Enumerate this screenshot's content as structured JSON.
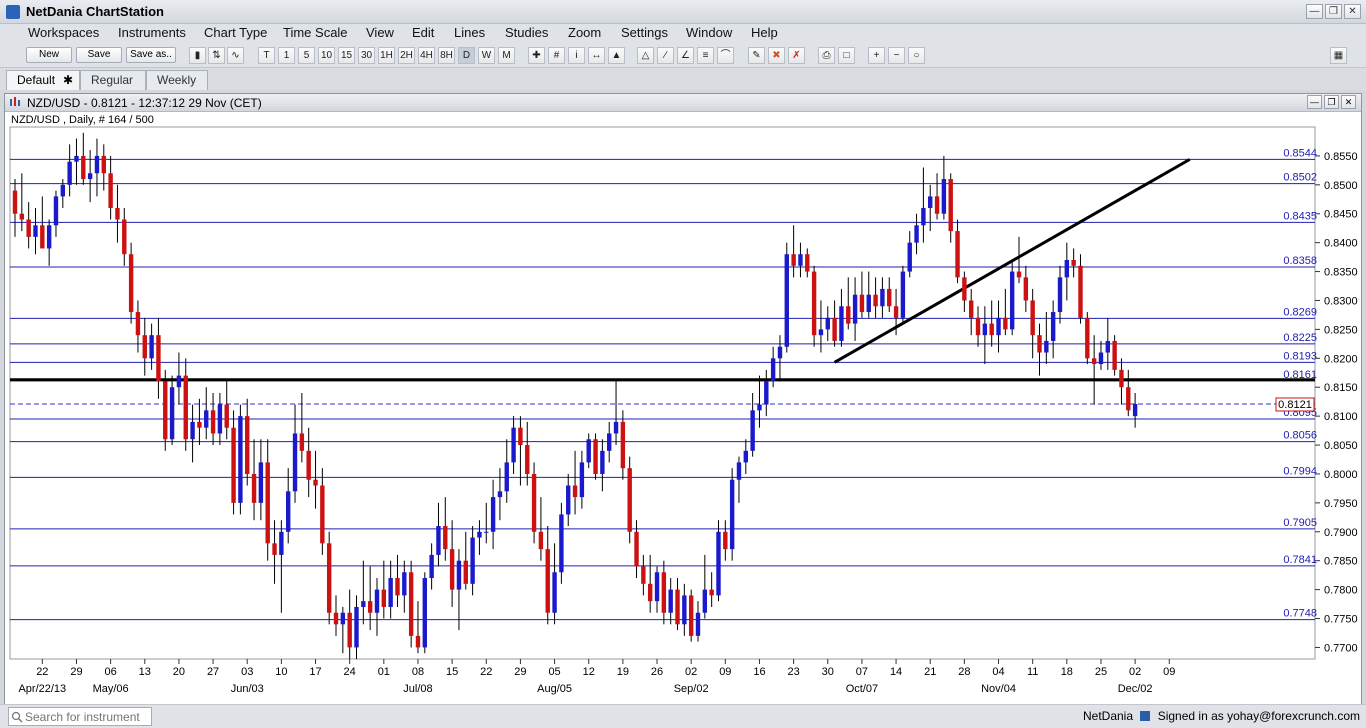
{
  "app": {
    "title": "NetDania ChartStation"
  },
  "menu": [
    "Workspaces",
    "Instruments",
    "Chart Type",
    "Time Scale",
    "View",
    "Edit",
    "Lines",
    "Studies",
    "Zoom",
    "Settings",
    "Window",
    "Help"
  ],
  "toolbar": {
    "new_label": "New",
    "save_label": "Save",
    "save_as_label": "Save as..",
    "timescales": [
      "T",
      "1",
      "5",
      "10",
      "15",
      "30",
      "1H",
      "2H",
      "4H",
      "8H",
      "D",
      "W",
      "M"
    ]
  },
  "tabs": [
    "Default",
    "Regular",
    "Weekly"
  ],
  "chart_window": {
    "title": "NZD/USD - 0.8121 - 12:37:12  29 Nov (CET)"
  },
  "status": {
    "search_placeholder": "Search for instrument",
    "brand": "NetDania",
    "signed_in": "Signed in as yohay@forexcrunch.com"
  },
  "colors": {
    "bull": "#1a1acc",
    "bear": "#cc1111",
    "grid": "#2020b0",
    "price_line": "#3030d0"
  },
  "chart_data": {
    "type": "candlestick",
    "title": "NZD/USD , Daily, # 164 / 500",
    "ylim": [
      0.768,
      0.86
    ],
    "y_ticks": [
      0.855,
      0.85,
      0.845,
      0.84,
      0.835,
      0.83,
      0.825,
      0.82,
      0.815,
      0.81,
      0.805,
      0.8,
      0.795,
      0.79,
      0.785,
      0.78,
      0.775,
      0.77
    ],
    "y_tick_labels": [
      "0.8550",
      "0.8500",
      "0.8450",
      "0.8400",
      "0.8350",
      "0.8300",
      "0.8250",
      "0.8200",
      "0.8150",
      "0.8100",
      "0.8050",
      "0.8000",
      "0.7950",
      "0.7900",
      "0.7850",
      "0.7800",
      "0.7750",
      "0.7700"
    ],
    "x_ticks": [
      {
        "i": 4,
        "day": "22",
        "month": "Apr/22/13"
      },
      {
        "i": 9,
        "day": "29"
      },
      {
        "i": 14,
        "day": "06",
        "month": "May/06"
      },
      {
        "i": 19,
        "day": "13"
      },
      {
        "i": 24,
        "day": "20"
      },
      {
        "i": 29,
        "day": "27"
      },
      {
        "i": 34,
        "day": "03",
        "month": "Jun/03"
      },
      {
        "i": 39,
        "day": "10"
      },
      {
        "i": 44,
        "day": "17"
      },
      {
        "i": 49,
        "day": "24"
      },
      {
        "i": 54,
        "day": "01"
      },
      {
        "i": 59,
        "day": "08",
        "month": "Jul/08"
      },
      {
        "i": 64,
        "day": "15"
      },
      {
        "i": 69,
        "day": "22"
      },
      {
        "i": 74,
        "day": "29"
      },
      {
        "i": 79,
        "day": "05",
        "month": "Aug/05"
      },
      {
        "i": 84,
        "day": "12"
      },
      {
        "i": 89,
        "day": "19"
      },
      {
        "i": 94,
        "day": "26"
      },
      {
        "i": 99,
        "day": "02",
        "month": "Sep/02"
      },
      {
        "i": 104,
        "day": "09"
      },
      {
        "i": 109,
        "day": "16"
      },
      {
        "i": 114,
        "day": "23"
      },
      {
        "i": 119,
        "day": "30"
      },
      {
        "i": 124,
        "day": "07",
        "month": "Oct/07"
      },
      {
        "i": 129,
        "day": "14"
      },
      {
        "i": 134,
        "day": "21"
      },
      {
        "i": 139,
        "day": "28"
      },
      {
        "i": 144,
        "day": "04",
        "month": "Nov/04"
      },
      {
        "i": 149,
        "day": "11"
      },
      {
        "i": 154,
        "day": "18"
      },
      {
        "i": 159,
        "day": "25"
      },
      {
        "i": 164,
        "day": "02",
        "month": "Dec/02"
      },
      {
        "i": 169,
        "day": "09"
      }
    ],
    "levels": [
      0.8544,
      0.8502,
      0.8435,
      0.8358,
      0.8269,
      0.8225,
      0.8193,
      0.8161,
      0.8095,
      0.8056,
      0.7994,
      0.7905,
      0.7841,
      0.7748
    ],
    "level_labels": [
      "0.8544",
      "0.8502",
      "0.8435",
      "0.8358",
      "0.8269",
      "0.8225",
      "0.8193",
      "0.8161",
      "0.8095",
      "0.8056",
      "0.7994",
      "0.7905",
      "0.7841",
      "0.7748"
    ],
    "support_level": 0.8163,
    "current_price": 0.8121,
    "current_price_label": "0.8121",
    "trendlines": [
      {
        "from": {
          "i": 120,
          "price": 0.8193
        },
        "to": {
          "i": 172,
          "price": 0.8544
        }
      }
    ],
    "candles": [
      [
        0.849,
        0.851,
        0.841,
        0.845
      ],
      [
        0.845,
        0.852,
        0.842,
        0.844
      ],
      [
        0.844,
        0.847,
        0.839,
        0.841
      ],
      [
        0.841,
        0.846,
        0.838,
        0.843
      ],
      [
        0.843,
        0.848,
        0.84,
        0.839
      ],
      [
        0.839,
        0.844,
        0.836,
        0.843
      ],
      [
        0.843,
        0.849,
        0.841,
        0.848
      ],
      [
        0.848,
        0.851,
        0.846,
        0.85
      ],
      [
        0.85,
        0.857,
        0.848,
        0.854
      ],
      [
        0.854,
        0.858,
        0.85,
        0.855
      ],
      [
        0.855,
        0.859,
        0.85,
        0.851
      ],
      [
        0.851,
        0.856,
        0.847,
        0.852
      ],
      [
        0.852,
        0.858,
        0.848,
        0.855
      ],
      [
        0.855,
        0.857,
        0.849,
        0.852
      ],
      [
        0.852,
        0.855,
        0.844,
        0.846
      ],
      [
        0.846,
        0.85,
        0.84,
        0.844
      ],
      [
        0.844,
        0.846,
        0.836,
        0.838
      ],
      [
        0.838,
        0.84,
        0.826,
        0.828
      ],
      [
        0.828,
        0.83,
        0.821,
        0.824
      ],
      [
        0.824,
        0.827,
        0.817,
        0.82
      ],
      [
        0.82,
        0.826,
        0.818,
        0.824
      ],
      [
        0.824,
        0.827,
        0.813,
        0.816
      ],
      [
        0.816,
        0.818,
        0.804,
        0.806
      ],
      [
        0.806,
        0.817,
        0.805,
        0.815
      ],
      [
        0.815,
        0.821,
        0.812,
        0.817
      ],
      [
        0.817,
        0.82,
        0.804,
        0.806
      ],
      [
        0.806,
        0.812,
        0.802,
        0.809
      ],
      [
        0.809,
        0.813,
        0.805,
        0.808
      ],
      [
        0.808,
        0.815,
        0.806,
        0.811
      ],
      [
        0.811,
        0.814,
        0.805,
        0.807
      ],
      [
        0.807,
        0.814,
        0.805,
        0.812
      ],
      [
        0.812,
        0.816,
        0.806,
        0.808
      ],
      [
        0.808,
        0.811,
        0.793,
        0.795
      ],
      [
        0.795,
        0.812,
        0.793,
        0.81
      ],
      [
        0.81,
        0.813,
        0.798,
        0.8
      ],
      [
        0.8,
        0.806,
        0.792,
        0.795
      ],
      [
        0.795,
        0.806,
        0.792,
        0.802
      ],
      [
        0.802,
        0.806,
        0.785,
        0.788
      ],
      [
        0.788,
        0.792,
        0.781,
        0.786
      ],
      [
        0.786,
        0.792,
        0.776,
        0.79
      ],
      [
        0.79,
        0.801,
        0.788,
        0.797
      ],
      [
        0.797,
        0.812,
        0.795,
        0.807
      ],
      [
        0.807,
        0.814,
        0.802,
        0.804
      ],
      [
        0.804,
        0.808,
        0.796,
        0.799
      ],
      [
        0.799,
        0.804,
        0.794,
        0.798
      ],
      [
        0.798,
        0.801,
        0.786,
        0.788
      ],
      [
        0.788,
        0.79,
        0.774,
        0.776
      ],
      [
        0.776,
        0.779,
        0.772,
        0.774
      ],
      [
        0.774,
        0.777,
        0.769,
        0.776
      ],
      [
        0.776,
        0.78,
        0.768,
        0.77
      ],
      [
        0.77,
        0.779,
        0.768,
        0.777
      ],
      [
        0.777,
        0.785,
        0.774,
        0.778
      ],
      [
        0.778,
        0.784,
        0.773,
        0.776
      ],
      [
        0.776,
        0.782,
        0.772,
        0.78
      ],
      [
        0.78,
        0.785,
        0.775,
        0.777
      ],
      [
        0.777,
        0.785,
        0.775,
        0.782
      ],
      [
        0.782,
        0.786,
        0.777,
        0.779
      ],
      [
        0.779,
        0.785,
        0.776,
        0.783
      ],
      [
        0.783,
        0.785,
        0.77,
        0.772
      ],
      [
        0.772,
        0.778,
        0.769,
        0.77
      ],
      [
        0.77,
        0.783,
        0.769,
        0.782
      ],
      [
        0.782,
        0.788,
        0.78,
        0.786
      ],
      [
        0.786,
        0.795,
        0.784,
        0.791
      ],
      [
        0.791,
        0.796,
        0.785,
        0.787
      ],
      [
        0.787,
        0.792,
        0.777,
        0.78
      ],
      [
        0.78,
        0.787,
        0.773,
        0.785
      ],
      [
        0.785,
        0.79,
        0.78,
        0.781
      ],
      [
        0.781,
        0.791,
        0.779,
        0.789
      ],
      [
        0.789,
        0.792,
        0.786,
        0.79
      ],
      [
        0.79,
        0.795,
        0.788,
        0.79
      ],
      [
        0.79,
        0.799,
        0.787,
        0.796
      ],
      [
        0.796,
        0.801,
        0.792,
        0.797
      ],
      [
        0.797,
        0.806,
        0.795,
        0.802
      ],
      [
        0.802,
        0.81,
        0.8,
        0.808
      ],
      [
        0.808,
        0.81,
        0.798,
        0.805
      ],
      [
        0.805,
        0.809,
        0.798,
        0.8
      ],
      [
        0.8,
        0.802,
        0.788,
        0.79
      ],
      [
        0.79,
        0.796,
        0.785,
        0.787
      ],
      [
        0.787,
        0.791,
        0.774,
        0.776
      ],
      [
        0.776,
        0.788,
        0.774,
        0.783
      ],
      [
        0.783,
        0.795,
        0.781,
        0.793
      ],
      [
        0.793,
        0.8,
        0.791,
        0.798
      ],
      [
        0.798,
        0.804,
        0.793,
        0.796
      ],
      [
        0.796,
        0.804,
        0.794,
        0.802
      ],
      [
        0.802,
        0.807,
        0.801,
        0.806
      ],
      [
        0.806,
        0.807,
        0.799,
        0.8
      ],
      [
        0.8,
        0.806,
        0.797,
        0.804
      ],
      [
        0.804,
        0.809,
        0.802,
        0.807
      ],
      [
        0.807,
        0.816,
        0.805,
        0.809
      ],
      [
        0.809,
        0.811,
        0.799,
        0.801
      ],
      [
        0.801,
        0.803,
        0.788,
        0.79
      ],
      [
        0.79,
        0.792,
        0.782,
        0.784
      ],
      [
        0.784,
        0.786,
        0.779,
        0.781
      ],
      [
        0.781,
        0.786,
        0.776,
        0.778
      ],
      [
        0.778,
        0.784,
        0.776,
        0.783
      ],
      [
        0.783,
        0.785,
        0.774,
        0.776
      ],
      [
        0.776,
        0.782,
        0.774,
        0.78
      ],
      [
        0.78,
        0.782,
        0.773,
        0.774
      ],
      [
        0.774,
        0.781,
        0.772,
        0.779
      ],
      [
        0.779,
        0.78,
        0.771,
        0.772
      ],
      [
        0.772,
        0.778,
        0.771,
        0.776
      ],
      [
        0.776,
        0.786,
        0.775,
        0.78
      ],
      [
        0.78,
        0.783,
        0.777,
        0.779
      ],
      [
        0.779,
        0.792,
        0.778,
        0.79
      ],
      [
        0.79,
        0.792,
        0.785,
        0.787
      ],
      [
        0.787,
        0.801,
        0.785,
        0.799
      ],
      [
        0.799,
        0.803,
        0.795,
        0.802
      ],
      [
        0.802,
        0.806,
        0.8,
        0.804
      ],
      [
        0.804,
        0.814,
        0.803,
        0.811
      ],
      [
        0.811,
        0.817,
        0.808,
        0.812
      ],
      [
        0.812,
        0.818,
        0.81,
        0.816
      ],
      [
        0.816,
        0.822,
        0.815,
        0.82
      ],
      [
        0.82,
        0.824,
        0.816,
        0.822
      ],
      [
        0.822,
        0.84,
        0.821,
        0.838
      ],
      [
        0.838,
        0.843,
        0.834,
        0.836
      ],
      [
        0.836,
        0.84,
        0.834,
        0.838
      ],
      [
        0.838,
        0.839,
        0.834,
        0.835
      ],
      [
        0.835,
        0.836,
        0.822,
        0.824
      ],
      [
        0.824,
        0.83,
        0.821,
        0.825
      ],
      [
        0.825,
        0.829,
        0.823,
        0.827
      ],
      [
        0.827,
        0.83,
        0.822,
        0.823
      ],
      [
        0.823,
        0.832,
        0.822,
        0.829
      ],
      [
        0.829,
        0.834,
        0.825,
        0.826
      ],
      [
        0.826,
        0.834,
        0.823,
        0.831
      ],
      [
        0.831,
        0.835,
        0.827,
        0.828
      ],
      [
        0.828,
        0.835,
        0.827,
        0.831
      ],
      [
        0.831,
        0.834,
        0.827,
        0.829
      ],
      [
        0.829,
        0.834,
        0.827,
        0.832
      ],
      [
        0.832,
        0.834,
        0.828,
        0.829
      ],
      [
        0.829,
        0.832,
        0.824,
        0.827
      ],
      [
        0.827,
        0.836,
        0.826,
        0.835
      ],
      [
        0.835,
        0.842,
        0.834,
        0.84
      ],
      [
        0.84,
        0.845,
        0.838,
        0.843
      ],
      [
        0.843,
        0.853,
        0.84,
        0.846
      ],
      [
        0.846,
        0.85,
        0.842,
        0.848
      ],
      [
        0.848,
        0.852,
        0.844,
        0.845
      ],
      [
        0.845,
        0.855,
        0.844,
        0.851
      ],
      [
        0.851,
        0.852,
        0.84,
        0.842
      ],
      [
        0.842,
        0.844,
        0.833,
        0.834
      ],
      [
        0.834,
        0.835,
        0.828,
        0.83
      ],
      [
        0.83,
        0.832,
        0.824,
        0.827
      ],
      [
        0.827,
        0.829,
        0.822,
        0.824
      ],
      [
        0.824,
        0.829,
        0.819,
        0.826
      ],
      [
        0.826,
        0.83,
        0.822,
        0.824
      ],
      [
        0.824,
        0.83,
        0.821,
        0.827
      ],
      [
        0.827,
        0.832,
        0.824,
        0.825
      ],
      [
        0.825,
        0.837,
        0.824,
        0.835
      ],
      [
        0.835,
        0.841,
        0.833,
        0.834
      ],
      [
        0.834,
        0.836,
        0.828,
        0.83
      ],
      [
        0.83,
        0.832,
        0.82,
        0.824
      ],
      [
        0.824,
        0.826,
        0.817,
        0.821
      ],
      [
        0.821,
        0.828,
        0.819,
        0.823
      ],
      [
        0.823,
        0.83,
        0.82,
        0.828
      ],
      [
        0.828,
        0.836,
        0.826,
        0.834
      ],
      [
        0.834,
        0.84,
        0.83,
        0.837
      ],
      [
        0.837,
        0.839,
        0.834,
        0.836
      ],
      [
        0.836,
        0.838,
        0.826,
        0.827
      ],
      [
        0.827,
        0.828,
        0.819,
        0.82
      ],
      [
        0.82,
        0.824,
        0.812,
        0.819
      ],
      [
        0.819,
        0.823,
        0.818,
        0.821
      ],
      [
        0.821,
        0.827,
        0.818,
        0.823
      ],
      [
        0.823,
        0.824,
        0.817,
        0.818
      ],
      [
        0.818,
        0.82,
        0.812,
        0.815
      ],
      [
        0.815,
        0.818,
        0.81,
        0.811
      ],
      [
        0.81,
        0.814,
        0.808,
        0.8121
      ]
    ]
  }
}
